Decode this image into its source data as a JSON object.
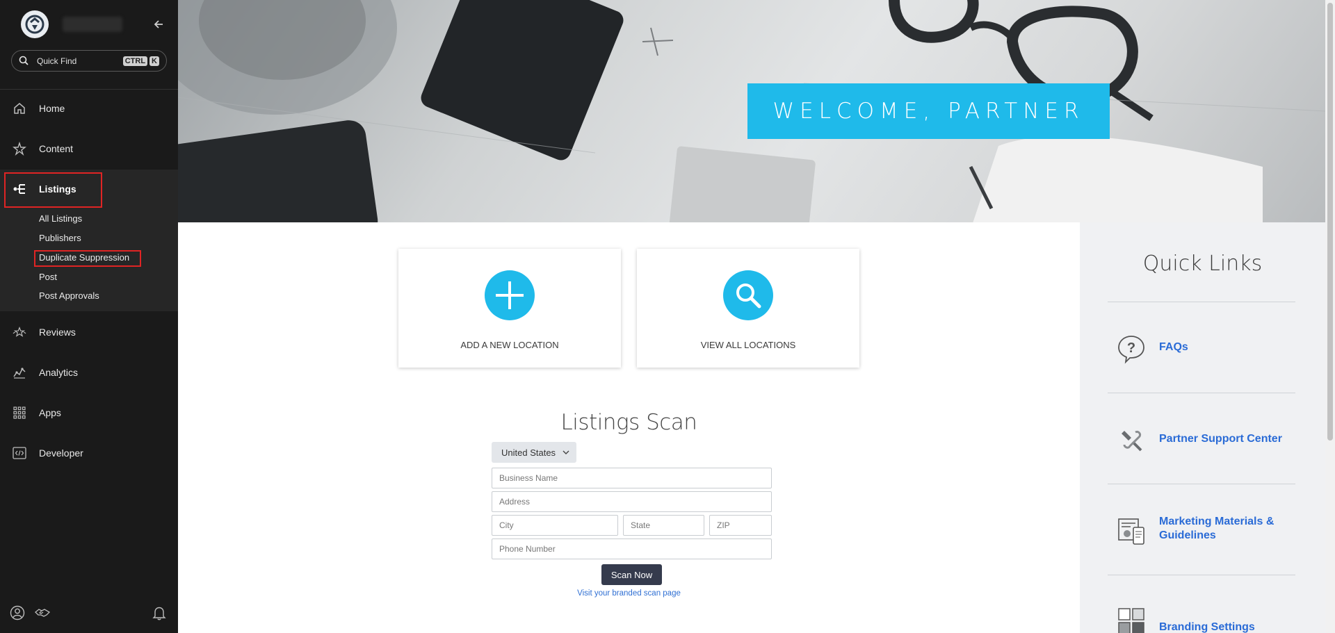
{
  "sidebar": {
    "quick_find": {
      "label": "Quick Find",
      "keys": [
        "CTRL",
        "K"
      ]
    },
    "nav": [
      {
        "label": "Home",
        "icon": "home-icon"
      },
      {
        "label": "Content",
        "icon": "content-icon"
      },
      {
        "label": "Listings",
        "icon": "listings-icon",
        "active": true
      },
      {
        "label": "Reviews",
        "icon": "reviews-icon"
      },
      {
        "label": "Analytics",
        "icon": "analytics-icon"
      },
      {
        "label": "Apps",
        "icon": "apps-grid-icon"
      },
      {
        "label": "Developer",
        "icon": "developer-code-icon"
      }
    ],
    "listings_sub": [
      "All Listings",
      "Publishers",
      "Duplicate Suppression",
      "Post",
      "Post Approvals"
    ],
    "bottom_icons": [
      "user-profile-icon",
      "partner-handshake-icon",
      "notification-bell-icon"
    ],
    "highlight_color": "#e02424"
  },
  "hero": {
    "banner_text": "WELCOME, PARTNER",
    "accent": "#1fbaea"
  },
  "actions": [
    {
      "label": "ADD A NEW LOCATION",
      "icon": "plus-icon"
    },
    {
      "label": "VIEW ALL LOCATIONS",
      "icon": "search-icon"
    }
  ],
  "scan": {
    "title": "Listings Scan",
    "country": "United States",
    "placeholders": {
      "business": "Business Name",
      "address": "Address",
      "city": "City",
      "state": "State",
      "zip": "ZIP",
      "phone": "Phone Number"
    },
    "button": "Scan Now",
    "link": "Visit your branded scan page"
  },
  "quick_links": {
    "title": "Quick Links",
    "items": [
      {
        "label": "FAQs",
        "icon": "faq-question-icon"
      },
      {
        "label": "Partner Support Center",
        "icon": "support-tools-icon"
      },
      {
        "label": "Marketing Materials & Guidelines",
        "icon": "marketing-materials-icon"
      },
      {
        "label": "Branding Settings",
        "icon": "branding-settings-icon"
      }
    ],
    "link_color": "#2a6bd6"
  }
}
